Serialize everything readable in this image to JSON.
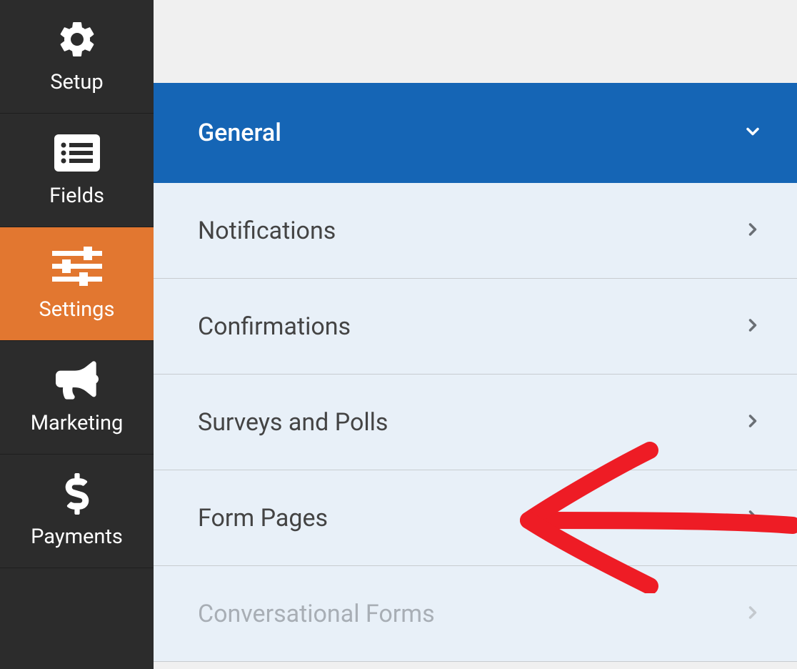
{
  "sidebar": {
    "items": [
      {
        "label": "Setup",
        "icon": "gear-icon",
        "active": false
      },
      {
        "label": "Fields",
        "icon": "list-icon",
        "active": false
      },
      {
        "label": "Settings",
        "icon": "sliders-icon",
        "active": true
      },
      {
        "label": "Marketing",
        "icon": "megaphone-icon",
        "active": false
      },
      {
        "label": "Payments",
        "icon": "dollar-icon",
        "active": false
      }
    ]
  },
  "settings_panel": {
    "items": [
      {
        "label": "General",
        "expanded": true,
        "active": true
      },
      {
        "label": "Notifications",
        "expanded": false,
        "active": false
      },
      {
        "label": "Confirmations",
        "expanded": false,
        "active": false
      },
      {
        "label": "Surveys and Polls",
        "expanded": false,
        "active": false
      },
      {
        "label": "Form Pages",
        "expanded": false,
        "active": false
      },
      {
        "label": "Conversational Forms",
        "expanded": false,
        "active": false,
        "disabled": true
      }
    ]
  }
}
